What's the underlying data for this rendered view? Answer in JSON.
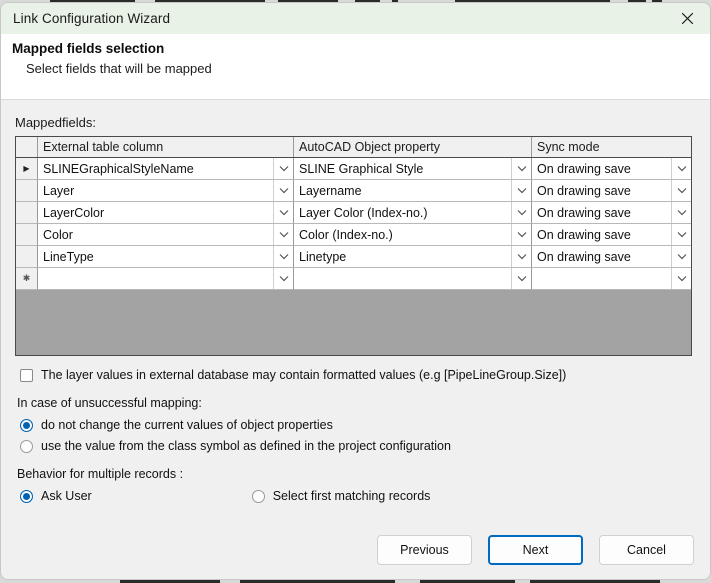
{
  "window": {
    "title": "Link Configuration Wizard",
    "close_icon": "close-icon"
  },
  "header": {
    "title": "Mapped fields selection",
    "subtitle": "Select fields that will be mapped"
  },
  "grid": {
    "label": "Mappedfields:",
    "columns": [
      "External table column",
      "AutoCAD Object property",
      "Sync mode"
    ],
    "current_row_marker": "▶",
    "new_row_marker": "✱",
    "rows": [
      {
        "external_table_column": "SLINEGraphicalStyleName",
        "autocad_object_property": "SLINE Graphical Style",
        "sync_mode": "On drawing save"
      },
      {
        "external_table_column": "Layer",
        "autocad_object_property": "Layername",
        "sync_mode": "On drawing save"
      },
      {
        "external_table_column": "LayerColor",
        "autocad_object_property": "Layer Color (Index-no.)",
        "sync_mode": "On drawing save"
      },
      {
        "external_table_column": "Color",
        "autocad_object_property": "Color (Index-no.)",
        "sync_mode": "On drawing save"
      },
      {
        "external_table_column": "LineType",
        "autocad_object_property": "Linetype",
        "sync_mode": "On drawing save"
      },
      {
        "external_table_column": "",
        "autocad_object_property": "",
        "sync_mode": ""
      }
    ]
  },
  "formatted_values_checkbox": {
    "label": "The layer values in external database may contain formatted values (e.g [PipeLineGroup.Size])",
    "checked": false
  },
  "unsuccessful_mapping": {
    "label": "In case of unsuccessful mapping:",
    "options": [
      {
        "label": "do not change the current values of object properties",
        "selected": true
      },
      {
        "label": "use the value from the class symbol as defined in the project configuration",
        "selected": false
      }
    ]
  },
  "multiple_records": {
    "label": "Behavior for multiple records :",
    "options": [
      {
        "label": "Ask User",
        "selected": true
      },
      {
        "label": "Select first matching records",
        "selected": false
      }
    ]
  },
  "footer": {
    "previous_label": "Previous",
    "next_label": "Next",
    "cancel_label": "Cancel"
  },
  "colors": {
    "titlebar": "#e8f2e6",
    "accent": "#0063b1",
    "focus_border": "#0069c0",
    "grid_empty": "#a3a3a3"
  }
}
